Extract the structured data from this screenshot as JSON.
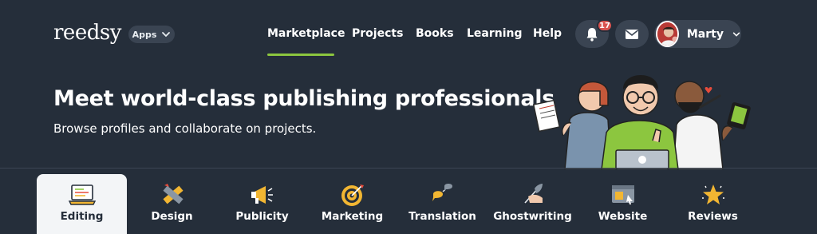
{
  "header": {
    "logo_text": "reedsy",
    "apps_label": "Apps",
    "nav": [
      {
        "label": "Marketplace",
        "active": true
      },
      {
        "label": "Projects"
      },
      {
        "label": "Books"
      },
      {
        "label": "Learning"
      },
      {
        "label": "Help"
      }
    ],
    "notification_count": "17",
    "user_name": "Marty"
  },
  "hero": {
    "title": "Meet world-class publishing professionals",
    "subtitle": "Browse profiles and collaborate on projects."
  },
  "categories": [
    {
      "label": "Editing",
      "icon": "laptop-icon",
      "active": true
    },
    {
      "label": "Design",
      "icon": "ruler-pencil-icon"
    },
    {
      "label": "Publicity",
      "icon": "megaphone-icon"
    },
    {
      "label": "Marketing",
      "icon": "target-icon"
    },
    {
      "label": "Translation",
      "icon": "speech-bubbles-icon"
    },
    {
      "label": "Ghostwriting",
      "icon": "hand-quill-icon"
    },
    {
      "label": "Website",
      "icon": "browser-window-icon"
    },
    {
      "label": "Reviews",
      "icon": "star-icon"
    }
  ],
  "colors": {
    "background": "#252e3a",
    "accent_green": "#8cc63f",
    "badge_red": "#d9534f",
    "button_bg": "#3a4452",
    "active_tab_bg": "#f3f5f7"
  }
}
